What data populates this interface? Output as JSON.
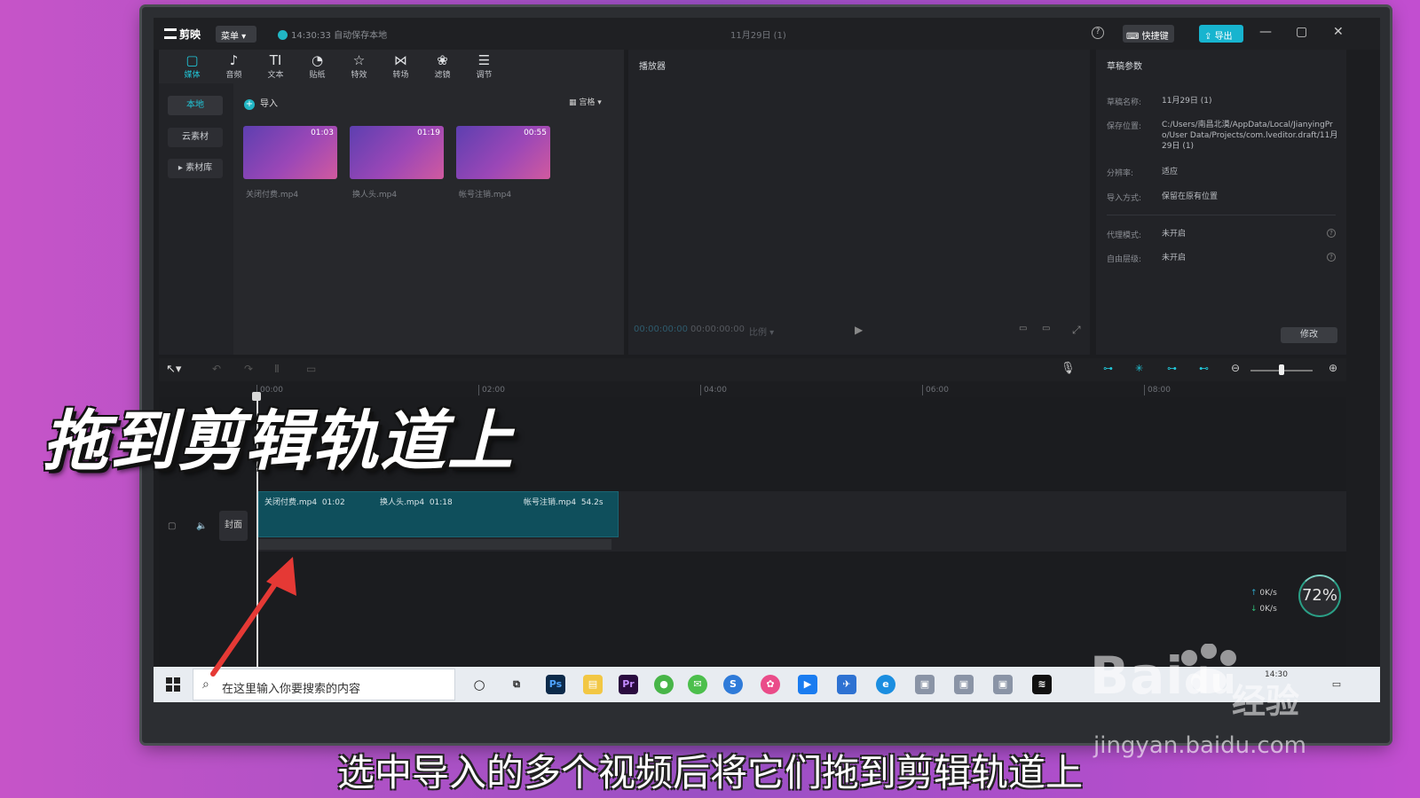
{
  "app": {
    "name": "剪映",
    "menu_label": "菜单",
    "autosave": "14:30:33 自动保存本地",
    "project_title": "11月29日 (1)",
    "help": "?",
    "shortcut_label": "快捷键",
    "export_label": "导出"
  },
  "tool_tabs": [
    {
      "label": "媒体",
      "icon": "▢",
      "active": true
    },
    {
      "label": "音频",
      "icon": "♪"
    },
    {
      "label": "文本",
      "icon": "TI"
    },
    {
      "label": "贴纸",
      "icon": "◔"
    },
    {
      "label": "特效",
      "icon": "☆"
    },
    {
      "label": "转场",
      "icon": "⋈"
    },
    {
      "label": "滤镜",
      "icon": "❀"
    },
    {
      "label": "调节",
      "icon": "☰"
    }
  ],
  "side_nav": {
    "local": "本地",
    "cloud": "云素材",
    "library": "素材库"
  },
  "media": {
    "import_label": "导入",
    "view_label": "宫格",
    "items": [
      {
        "name": "关闭付费.mp4",
        "duration": "01:03"
      },
      {
        "name": "换人头.mp4",
        "duration": "01:19"
      },
      {
        "name": "帐号注销.mp4",
        "duration": "00:55"
      }
    ]
  },
  "player": {
    "title": "播放器",
    "current_time": "00:00:00:00",
    "total_time": "00:00:00:00",
    "ratio": "比例"
  },
  "params": {
    "title": "草稿参数",
    "rows": [
      {
        "label": "草稿名称:",
        "value": "11月29日 (1)"
      },
      {
        "label": "保存位置:",
        "value": "C:/Users/南昌北漠/AppData/Local/JianyingPro/User Data/Projects/com.lveditor.draft/11月29日 (1)"
      },
      {
        "label": "分辨率:",
        "value": "适应"
      },
      {
        "label": "导入方式:",
        "value": "保留在原有位置"
      },
      {
        "label": "代理模式:",
        "value": "未开启"
      },
      {
        "label": "自由层级:",
        "value": "未开启"
      }
    ],
    "modify_label": "修改"
  },
  "timeline": {
    "ticks": [
      "00:00",
      "02:00",
      "04:00",
      "06:00",
      "08:00"
    ],
    "cover_label": "封面",
    "clips": [
      {
        "name": "关闭付费.mp4",
        "duration": "01:02"
      },
      {
        "name": "换人头.mp4",
        "duration": "01:18"
      },
      {
        "name": "帐号注销.mp4",
        "duration": "54.2s"
      }
    ],
    "upload_speed": "0K/s",
    "download_speed": "0K/s",
    "cpu": "72%"
  },
  "taskbar": {
    "search_placeholder": "在这里输入你要搜索的内容",
    "clock": "14:30"
  },
  "overlay": {
    "big_caption": "拖到剪辑轨道上",
    "subtitle": "选中导入的多个视频后将它们拖到剪辑轨道上",
    "watermark": "Bai",
    "watermark_du": "du",
    "watermark_jy": "经验",
    "watermark_url": "jingyan.baidu.com"
  },
  "colors": {
    "accent": "#21c5d7",
    "clip": "#0f4f5c",
    "arrow": "#e53935"
  }
}
